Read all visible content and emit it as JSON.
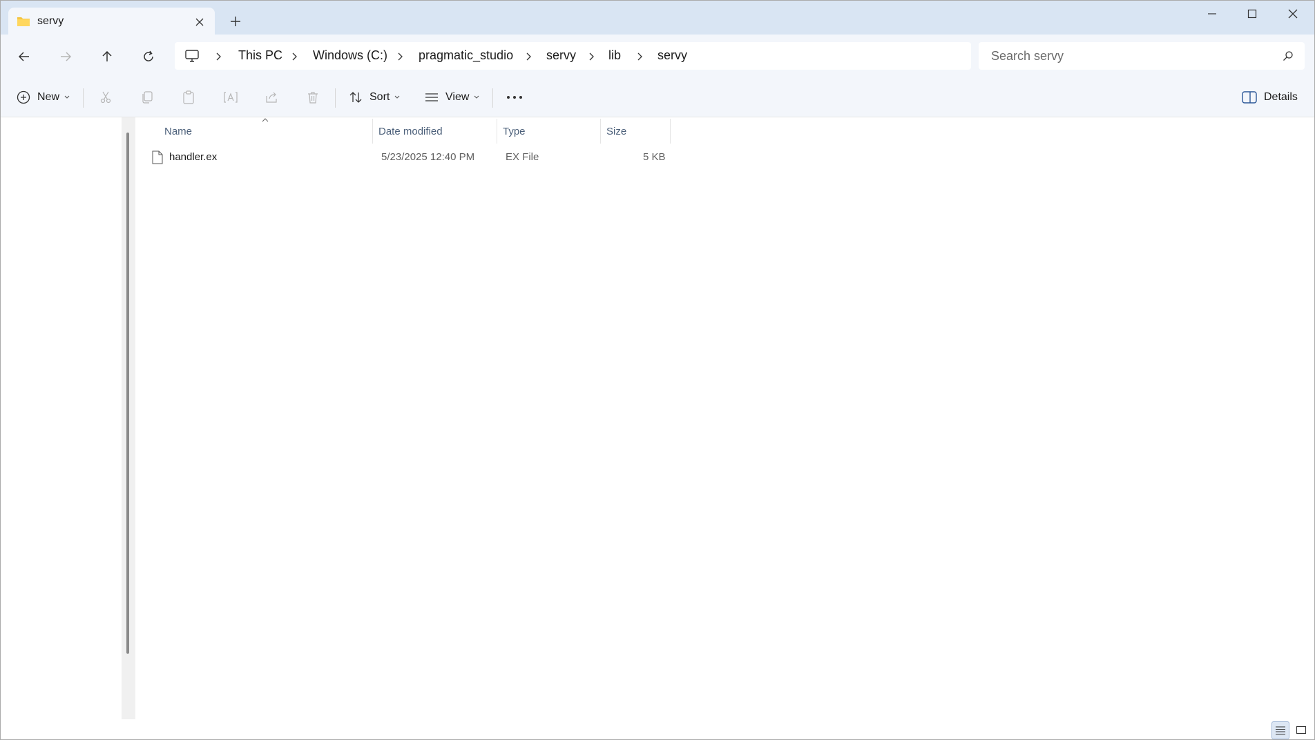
{
  "tab": {
    "title": "servy",
    "new_tab_label": "+"
  },
  "address": {
    "crumbs": [
      "This PC",
      "Windows (C:)",
      "pragmatic_studio",
      "servy",
      "lib",
      "servy"
    ]
  },
  "search": {
    "placeholder": "Search servy"
  },
  "commands": {
    "new_label": "New",
    "sort_label": "Sort",
    "view_label": "View",
    "details_label": "Details"
  },
  "columns": {
    "name": "Name",
    "date_modified": "Date modified",
    "type": "Type",
    "size": "Size"
  },
  "files": [
    {
      "name": "handler.ex",
      "date_modified": "5/23/2025 12:40 PM",
      "type": "EX File",
      "size": "5 KB"
    }
  ],
  "colors": {
    "titlebar": "#d9e5f3",
    "toolbar": "#f3f6fb",
    "folder": "#f4c542",
    "text": "#1b1b1b"
  }
}
